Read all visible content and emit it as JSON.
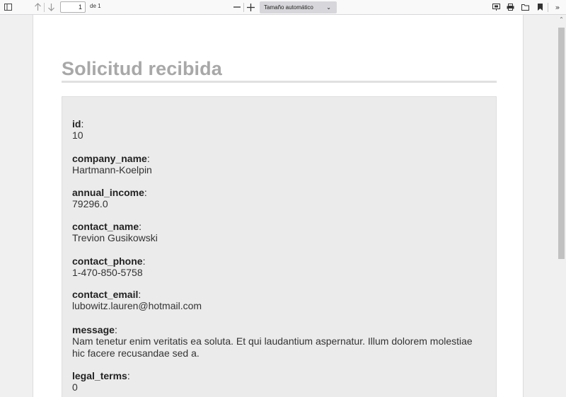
{
  "toolbar": {
    "page_number": "1",
    "page_count": "de 1",
    "zoom_label": "Tamaño automático"
  },
  "document": {
    "title": "Solicitud recibida",
    "fields": [
      {
        "name": "id",
        "value": "10"
      },
      {
        "name": "company_name",
        "value": "Hartmann-Koelpin"
      },
      {
        "name": "annual_income",
        "value": "79296.0"
      },
      {
        "name": "contact_name",
        "value": "Trevion Gusikowski"
      },
      {
        "name": "contact_phone",
        "value": "1-470-850-5758"
      },
      {
        "name": "contact_email",
        "value": "lubowitz.lauren@hotmail.com"
      },
      {
        "name": "message",
        "value": "Nam tenetur enim veritatis ea soluta. Et qui laudantium aspernatur. Illum dolorem molestiae hic facere recusandae sed a."
      },
      {
        "name": "legal_terms",
        "value": "0"
      }
    ]
  },
  "icons": {
    "sidebar": "sidebar-toggle-icon",
    "prev": "arrow-up-icon",
    "next": "arrow-down-icon",
    "zoom_out": "minus-icon",
    "zoom_in": "plus-icon",
    "presentation": "presentation-icon",
    "print": "print-icon",
    "open": "folder-open-icon",
    "bookmark": "bookmark-icon",
    "tools": "double-chevron-right-icon"
  }
}
